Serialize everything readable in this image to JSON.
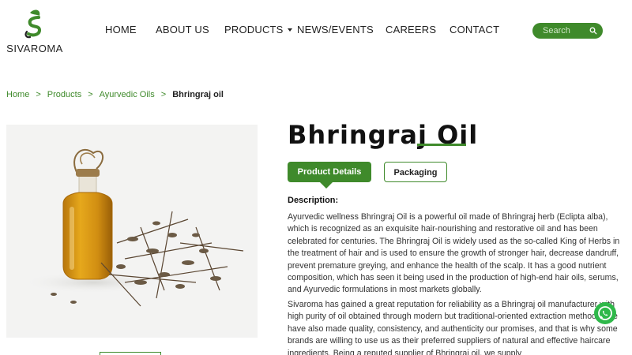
{
  "brand": {
    "name": "SIVAROMA",
    "accent": "#3f8a2b"
  },
  "nav": {
    "items": [
      {
        "label": "HOME"
      },
      {
        "label": "ABOUT US"
      },
      {
        "label": "PRODUCTS"
      },
      {
        "label": "NEWS/EVENTS"
      },
      {
        "label": "CAREERS"
      },
      {
        "label": "CONTACT"
      }
    ],
    "search_placeholder": "Search"
  },
  "breadcrumb": {
    "items": [
      "Home",
      "Products",
      "Ayurvedic Oils"
    ],
    "separator": ">",
    "current": "Bhringraj oil"
  },
  "product": {
    "title": "Bhringraj Oil",
    "tabs": [
      "Product Details",
      "Packaging"
    ],
    "description_heading": "Description:",
    "paragraphs": [
      "Ayurvedic wellness Bhringraj Oil is a powerful oil made of Bhringraj herb (Eclipta alba), which is recognized as an exquisite hair-nourishing and restorative oil and has been celebrated for centuries. The Bhringraj Oil is widely used as the so-called King of Herbs in the treatment of hair and is used to ensure the growth of stronger hair, decrease dandruff, prevent premature greying, and enhance the health of the scalp. It has a good nutrient composition, which has seen it being used in the production of high-end hair oils, serums, and Ayurvedic formulations in most markets globally.",
      "Sivaroma has gained a great reputation for reliability as a Bhringraj oil manufacturer with high purity of oil obtained through modern but traditional-oriented extraction methods. We have also made quality, consistency, and authenticity our promises, and that is why some brands are willing to use us as their preferred suppliers of natural and effective haircare ingredients. Being a reputed supplier of Bhringraj oil, we supply"
    ]
  }
}
